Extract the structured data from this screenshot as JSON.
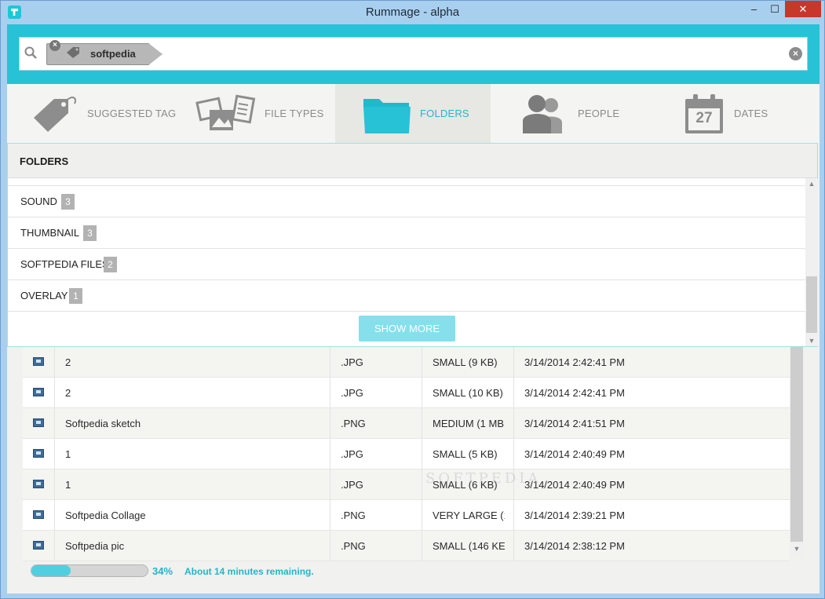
{
  "window": {
    "title": "Rummage - alpha",
    "min": "–",
    "max": "☐",
    "close": "✕"
  },
  "search": {
    "tag": "softpedia",
    "remove": "×",
    "clear": "×"
  },
  "tabs": [
    {
      "label": "SUGGESTED TAG",
      "icon": "tag-icon"
    },
    {
      "label": "FILE TYPES",
      "icon": "file-types-icon"
    },
    {
      "label": "FOLDERS",
      "icon": "folder-icon"
    },
    {
      "label": "PEOPLE",
      "icon": "people-icon"
    },
    {
      "label": "DATES",
      "icon": "calendar-icon",
      "day": "27"
    }
  ],
  "folders": {
    "title": "FOLDERS",
    "items": [
      {
        "name": "SOUND",
        "count": "3"
      },
      {
        "name": "THUMBNAIL",
        "count": "3"
      },
      {
        "name": "SOFTPEDIA FILES",
        "count": "2"
      },
      {
        "name": "OVERLAY",
        "count": "1"
      }
    ],
    "show_more": "SHOW MORE"
  },
  "results": [
    {
      "name": "2",
      "type": ".JPG",
      "size": "SMALL (9 KB)",
      "date": "3/14/2014 2:42:41 PM"
    },
    {
      "name": "2",
      "type": ".JPG",
      "size": "SMALL (10 KB)",
      "date": "3/14/2014 2:42:41 PM"
    },
    {
      "name": "Softpedia sketch",
      "type": ".PNG",
      "size": "MEDIUM (1 MB",
      "date": "3/14/2014 2:41:51 PM"
    },
    {
      "name": "1",
      "type": ".JPG",
      "size": "SMALL (5 KB)",
      "date": "3/14/2014 2:40:49 PM"
    },
    {
      "name": "1",
      "type": ".JPG",
      "size": "SMALL (6 KB)",
      "date": "3/14/2014 2:40:49 PM"
    },
    {
      "name": "Softpedia Collage",
      "type": ".PNG",
      "size": "VERY LARGE (1",
      "date": "3/14/2014 2:39:21 PM"
    },
    {
      "name": "Softpedia pic",
      "type": ".PNG",
      "size": "SMALL (146 KE",
      "date": "3/14/2014 2:38:12 PM"
    }
  ],
  "status": {
    "percent_value": 0.34,
    "percent": "34%",
    "remaining": "About 14 minutes remaining."
  },
  "colors": {
    "accent": "#27c2d6",
    "active_tab": "#22b7cc",
    "count_badge": "#b2b2b2"
  }
}
